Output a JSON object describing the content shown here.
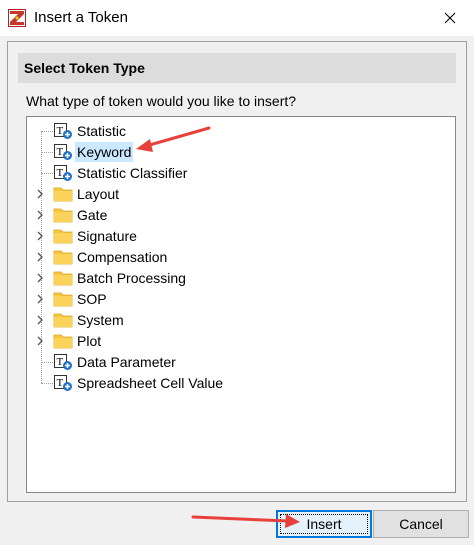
{
  "window": {
    "title": "Insert a Token",
    "close_glyph": "✕"
  },
  "header": {
    "title": "Select Token Type"
  },
  "prompt": "What type of token would you like to insert?",
  "tree": {
    "items": [
      {
        "label": "Statistic",
        "icon": "token-icon",
        "expandable": false,
        "selected": false
      },
      {
        "label": "Keyword",
        "icon": "token-icon",
        "expandable": false,
        "selected": true
      },
      {
        "label": "Statistic Classifier",
        "icon": "token-icon",
        "expandable": false,
        "selected": false
      },
      {
        "label": "Layout",
        "icon": "folder-icon",
        "expandable": true,
        "selected": false
      },
      {
        "label": "Gate",
        "icon": "folder-icon",
        "expandable": true,
        "selected": false
      },
      {
        "label": "Signature",
        "icon": "folder-icon",
        "expandable": true,
        "selected": false
      },
      {
        "label": "Compensation",
        "icon": "folder-icon",
        "expandable": true,
        "selected": false
      },
      {
        "label": "Batch Processing",
        "icon": "folder-icon",
        "expandable": true,
        "selected": false
      },
      {
        "label": "SOP",
        "icon": "folder-icon",
        "expandable": true,
        "selected": false
      },
      {
        "label": "System",
        "icon": "folder-icon",
        "expandable": true,
        "selected": false
      },
      {
        "label": "Plot",
        "icon": "folder-icon",
        "expandable": true,
        "selected": false
      },
      {
        "label": "Data Parameter",
        "icon": "token-icon",
        "expandable": false,
        "selected": false
      },
      {
        "label": "Spreadsheet Cell Value",
        "icon": "token-icon",
        "expandable": false,
        "selected": false
      }
    ]
  },
  "buttons": {
    "insert_label": "Insert",
    "cancel_label": "Cancel"
  },
  "colors": {
    "accent": "#0078d7",
    "selection": "#cce8ff",
    "annotation_arrow": "#e8413c",
    "folder": "#f8c63d",
    "token_badge": "#1e72c8"
  }
}
